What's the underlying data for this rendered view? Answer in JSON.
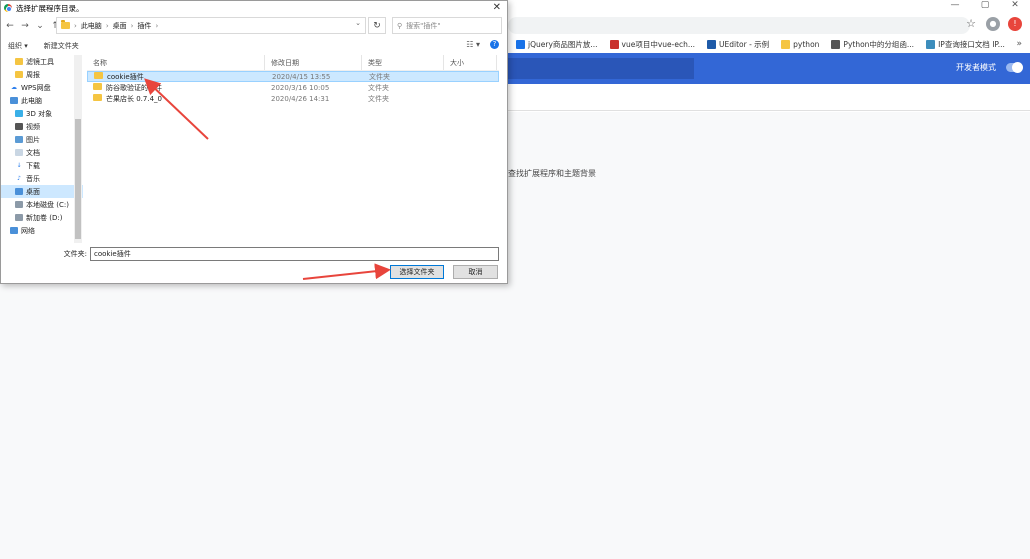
{
  "browser": {
    "win_controls": [
      "—",
      "▢",
      "✕"
    ],
    "bookmarks": [
      {
        "label": "jQuery商品图片放...",
        "icon": "jquery-icon",
        "color": "#1a73e8"
      },
      {
        "label": "vue项目中vue-ech...",
        "icon": "csdn-icon",
        "color": "#c9302c"
      },
      {
        "label": "UEditor - 示例",
        "icon": "ueditor-icon",
        "color": "#1e5aa8"
      },
      {
        "label": "python",
        "icon": "folder-icon",
        "color": "#f5c542"
      },
      {
        "label": "Python中的分组函...",
        "icon": "python-icon",
        "color": "#555555"
      },
      {
        "label": "IP查询接口文档 IP...",
        "icon": "ip-icon",
        "color": "#3c8dbc"
      }
    ],
    "bookmark_more": "»",
    "dev_mode_label": "开发者模式",
    "content_text": "查找扩展程序和主题背景",
    "accent": "#3367d6"
  },
  "dialog": {
    "title": "选择扩展程序目录。",
    "close": "✕",
    "nav": {
      "back": "←",
      "forward": "→",
      "dropdown": "⌄",
      "up": "↑"
    },
    "path": [
      "此电脑",
      "桌面",
      "插件"
    ],
    "search_placeholder": "搜索\"插件\"",
    "organize": "组织 ▾",
    "new_folder": "新建文件夹",
    "sidebar": [
      {
        "label": "滤镜工具",
        "icon": "folder-icon",
        "indent": 1,
        "selected": false
      },
      {
        "label": "周报",
        "icon": "folder-icon",
        "indent": 1,
        "selected": false
      },
      {
        "label": "WPS网盘",
        "icon": "cloud-icon",
        "indent": 0,
        "selected": false
      },
      {
        "label": "此电脑",
        "icon": "computer-icon",
        "indent": 0,
        "selected": false
      },
      {
        "label": "3D 对象",
        "icon": "cube-icon",
        "indent": 1,
        "selected": false
      },
      {
        "label": "视频",
        "icon": "video-icon",
        "indent": 1,
        "selected": false
      },
      {
        "label": "图片",
        "icon": "picture-icon",
        "indent": 1,
        "selected": false
      },
      {
        "label": "文档",
        "icon": "document-icon",
        "indent": 1,
        "selected": false
      },
      {
        "label": "下载",
        "icon": "download-icon",
        "indent": 1,
        "selected": false
      },
      {
        "label": "音乐",
        "icon": "music-icon",
        "indent": 1,
        "selected": false
      },
      {
        "label": "桌面",
        "icon": "desktop-icon",
        "indent": 1,
        "selected": true
      },
      {
        "label": "本地磁盘 (C:)",
        "icon": "drive-icon",
        "indent": 1,
        "selected": false
      },
      {
        "label": "新加卷 (D:)",
        "icon": "drive-icon",
        "indent": 1,
        "selected": false
      },
      {
        "label": "网络",
        "icon": "network-icon",
        "indent": 0,
        "selected": false
      }
    ],
    "columns": [
      "名称",
      "修改日期",
      "类型",
      "大小"
    ],
    "files": [
      {
        "name": "cookie插件",
        "date": "2020/4/15 13:55",
        "type": "文件夹",
        "size": "",
        "selected": true
      },
      {
        "name": "防谷歌验证的插件",
        "date": "2020/3/16 10:05",
        "type": "文件夹",
        "size": "",
        "selected": false
      },
      {
        "name": "芒果店长 0.7.4_0",
        "date": "2020/4/26 14:31",
        "type": "文件夹",
        "size": "",
        "selected": false
      }
    ],
    "filename_label": "文件夹:",
    "filename_value": "cookie插件",
    "select_button": "选择文件夹",
    "cancel_button": "取消"
  }
}
